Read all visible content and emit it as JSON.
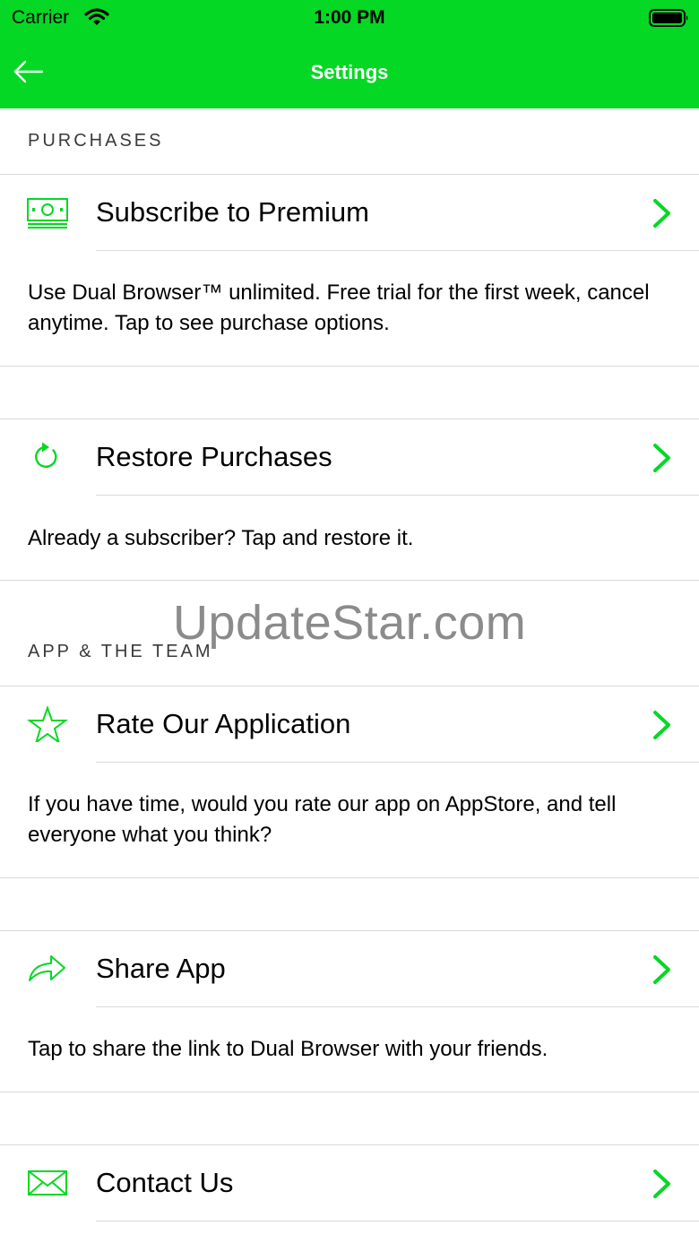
{
  "status_bar": {
    "carrier": "Carrier",
    "time": "1:00 PM"
  },
  "nav": {
    "title": "Settings"
  },
  "sections": {
    "purchases": "PURCHASES",
    "app_team": "APP & THE TEAM"
  },
  "rows": {
    "premium": {
      "label": "Subscribe to Premium",
      "description": "Use Dual Browser™ unlimited. Free trial for the first week, cancel anytime. Tap to see purchase options.",
      "icon": "money-icon"
    },
    "restore": {
      "label": "Restore Purchases",
      "description": "Already a subscriber? Tap and restore it.",
      "icon": "refresh-icon"
    },
    "rate": {
      "label": "Rate Our Application",
      "description": "If you have time, would you rate our app on AppStore, and tell everyone what you think?",
      "icon": "star-icon"
    },
    "share": {
      "label": "Share App",
      "description": "Tap to share the link to Dual Browser with your friends.",
      "icon": "share-icon"
    },
    "contact": {
      "label": "Contact Us",
      "icon": "mail-icon"
    }
  },
  "watermark": "UpdateStar.com",
  "colors": {
    "accent": "#04d824",
    "nav_text": "#ffffff",
    "separator": "#d9d9dc"
  }
}
